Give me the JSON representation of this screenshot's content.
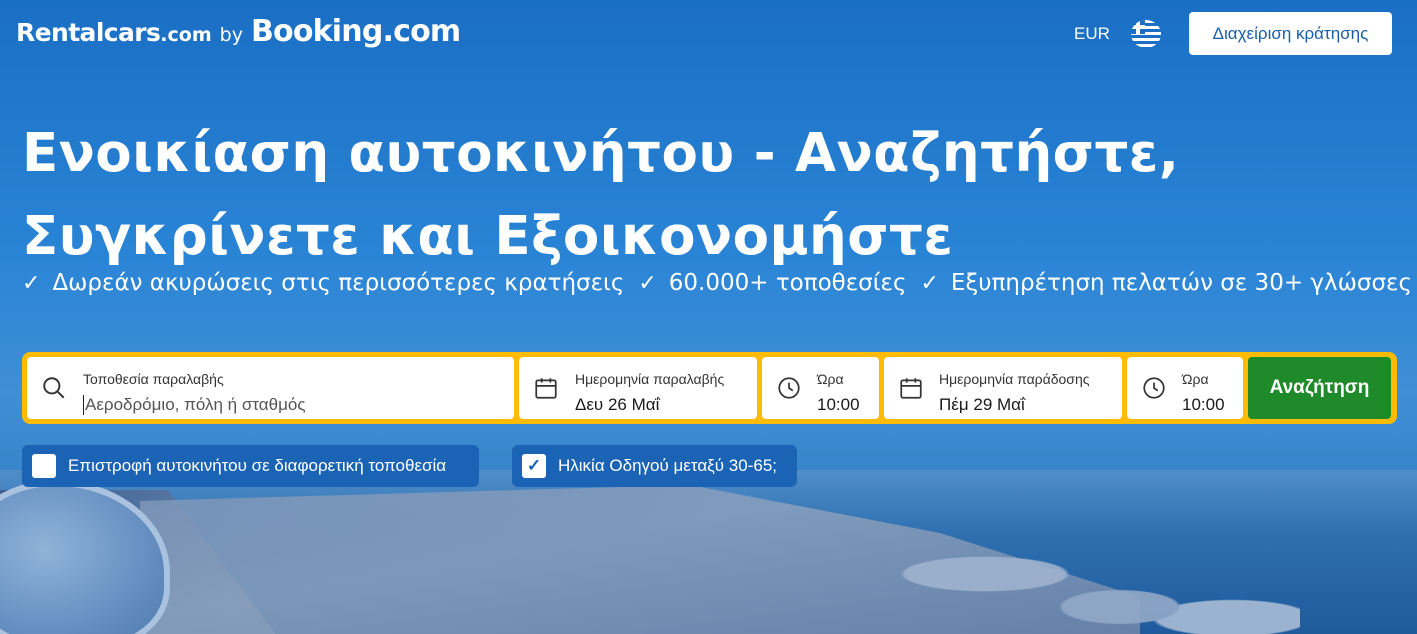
{
  "header": {
    "logo": {
      "rentalcars": "Rentalcars",
      "dotcom": ".com",
      "by": "by",
      "booking": "Booking.com"
    },
    "currency": "EUR",
    "language_flag_icon": "greek-flag-icon",
    "manage_booking_label": "Διαχείριση κράτησης"
  },
  "hero": {
    "title_line1": "Ενοικίαση αυτοκινήτου - Αναζητήστε,",
    "title_line2": "Συγκρίνετε και Εξοικονομήστε",
    "features": [
      "Δωρεάν ακυρώσεις στις περισσότερες κρατήσεις",
      "60.000+ τοποθεσίες",
      "Εξυπηρέτηση πελατών σε 30+ γλώσσες"
    ]
  },
  "search": {
    "pickup_location": {
      "label": "Τοποθεσία παραλαβής",
      "placeholder": "Αεροδρόμιο, πόλη ή σταθμός",
      "icon": "search-icon"
    },
    "pickup_date": {
      "label": "Ημερομηνία παραλαβής",
      "value": "Δευ 26 Μαΐ",
      "icon": "calendar-icon"
    },
    "pickup_time": {
      "label": "Ώρα",
      "value": "10:00",
      "icon": "clock-icon"
    },
    "dropoff_date": {
      "label": "Ημερομηνία παράδοσης",
      "value": "Πέμ 29 Μαΐ",
      "icon": "calendar-icon"
    },
    "dropoff_time": {
      "label": "Ώρα",
      "value": "10:00",
      "icon": "clock-icon"
    },
    "search_button_label": "Αναζήτηση"
  },
  "options": {
    "different_return": {
      "label": "Επιστροφή αυτοκινήτου σε διαφορετική τοποθεσία",
      "checked": false
    },
    "driver_age": {
      "label": "Ηλικία Οδηγού μεταξύ 30-65;",
      "checked": true
    }
  },
  "colors": {
    "primary_blue": "#1a6fc4",
    "search_border": "#febb02",
    "search_button": "#1f8a2a"
  }
}
